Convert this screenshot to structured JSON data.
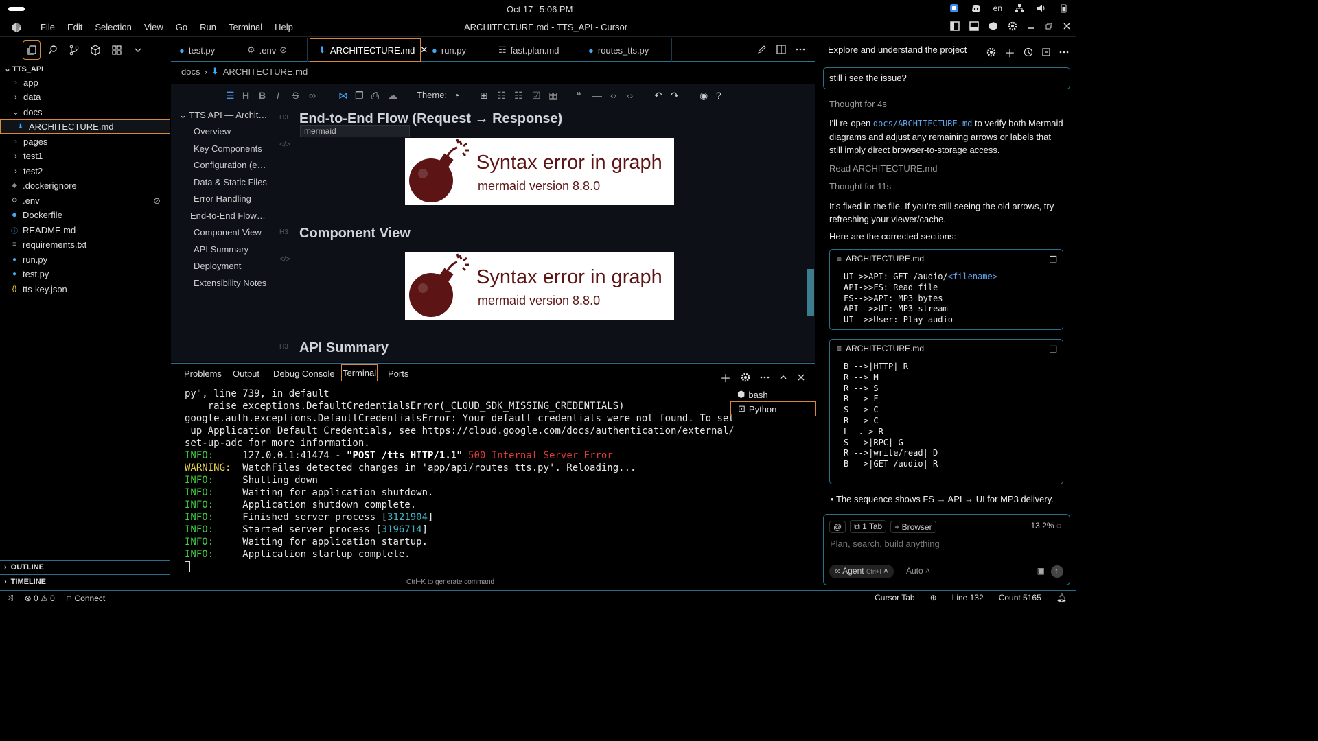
{
  "system": {
    "date": "Oct 17",
    "time": "5:06 PM",
    "lang": "en"
  },
  "window": {
    "title": "ARCHITECTURE.md - TTS_API - Cursor"
  },
  "menu": [
    "File",
    "Edit",
    "Selection",
    "View",
    "Go",
    "Run",
    "Terminal",
    "Help"
  ],
  "explorer": {
    "root": "TTS_API",
    "items": [
      {
        "label": "app",
        "kind": "folder"
      },
      {
        "label": "data",
        "kind": "folder"
      },
      {
        "label": "docs",
        "kind": "folder-open"
      },
      {
        "label": "ARCHITECTURE.md",
        "kind": "md"
      },
      {
        "label": "pages",
        "kind": "folder"
      },
      {
        "label": "test1",
        "kind": "folder"
      },
      {
        "label": "test2",
        "kind": "folder"
      },
      {
        "label": ".dockerignore",
        "kind": "docker"
      },
      {
        "label": ".env",
        "kind": "gear"
      },
      {
        "label": "Dockerfile",
        "kind": "docker"
      },
      {
        "label": "README.md",
        "kind": "info"
      },
      {
        "label": "requirements.txt",
        "kind": "lines"
      },
      {
        "label": "run.py",
        "kind": "py"
      },
      {
        "label": "test.py",
        "kind": "py"
      },
      {
        "label": "tts-key.json",
        "kind": "json"
      }
    ],
    "outline": "OUTLINE",
    "timeline": "TIMELINE"
  },
  "tabs": [
    "test.py",
    ".env",
    "ARCHITECTURE.md",
    "run.py",
    "fast.plan.md",
    "routes_tts.py"
  ],
  "breadcrumb": [
    "docs",
    "ARCHITECTURE.md"
  ],
  "toolbar": {
    "theme_label": "Theme:"
  },
  "toc": {
    "root": "TTS API — Archit…",
    "items": [
      "Overview",
      "Key Components",
      "Configuration (e…",
      "Data & Static Files",
      "Error Handling",
      "End-to-End Flow…",
      "Component View",
      "API Summary",
      "Deployment",
      "Extensibility Notes"
    ]
  },
  "doc": {
    "h3_tag": "H3",
    "code_tag": "</>",
    "tooltip": "mermaid",
    "headings": [
      "End-to-End Flow (Request → Response)",
      "Component View",
      "API Summary"
    ],
    "error_title": "Syntax error in graph",
    "error_version": "mermaid version 8.8.0"
  },
  "panel": {
    "tabs": [
      "Problems",
      "Output",
      "Debug Console",
      "Terminal",
      "Ports"
    ],
    "terminals": [
      "bash",
      "Python"
    ],
    "hint": "Ctrl+K to generate command",
    "lines": {
      "l1": "py\", line 739, in default",
      "l2": "    raise exceptions.DefaultCredentialsError(_CLOUD_SDK_MISSING_CREDENTIALS)",
      "l3": "google.auth.exceptions.DefaultCredentialsError: Your default credentials were not found. To set",
      "l4": " up Application Default Credentials, see https://cloud.google.com/docs/authentication/external/",
      "l5": "set-up-adc for more information.",
      "info": "INFO:",
      "warning": "WARNING:",
      "l6a": "     127.0.0.1:41474 - ",
      "l6b": "\"POST /tts HTTP/1.1\"",
      "l6c": "500 Internal Server Error",
      "l7": "  WatchFiles detected changes in 'app/api/routes_tts.py'. Reloading...",
      "l8": "     Shutting down",
      "l9": "     Waiting for application shutdown.",
      "l10": "     Application shutdown complete.",
      "l11a": "     Finished server process [",
      "l11b": "3121904",
      "l12a": "     Started server process [",
      "l12b": "3196714",
      "l13": "     Waiting for application startup.",
      "l14": "     Application startup complete.",
      "bracket": "]"
    }
  },
  "status": {
    "errors": "0",
    "warnings": "0",
    "connect": "Connect",
    "cursor_tab": "Cursor Tab",
    "line": "Line 132",
    "count": "Count 5165"
  },
  "chat": {
    "title": "Explore and understand the project",
    "user_message": "still i see the issue?",
    "thought1": "Thought for 4s",
    "p1_pre": "I'll re-open ",
    "p1_code": "docs/ARCHITECTURE.md",
    "p1_post": " to verify both Mermaid diagrams and adjust any remaining arrows or labels that still imply direct browser-to-storage access.",
    "read": "Read ARCHITECTURE.md",
    "thought2": "Thought for 11s",
    "p2": "It's fixed in the file. If you're still seeing the old arrows, try refreshing your viewer/cache.",
    "p3": "Here are the corrected sections:",
    "card_title": "ARCHITECTURE.md",
    "code1": [
      "UI->>API: GET /audio/",
      "API->>FS: Read file",
      "FS-->>API: MP3 bytes",
      "API-->>UI: MP3 stream",
      "UI-->>User: Play audio"
    ],
    "code1_link": "<filename>",
    "code2": [
      "B -->|HTTP| R",
      "R --> M",
      "R --> S",
      "R --> F",
      "S --> C",
      "R --> C",
      "L -.-> R",
      "S -->|RPC| G",
      "R -->|write/read| D",
      "B -->|GET /audio| R"
    ],
    "bullet": "The sequence shows FS → API → UI for MP3 delivery.",
    "composer": {
      "tab_chip": "1 Tab",
      "browser_chip": "Browser",
      "percent": "13.2%",
      "placeholder": "Plan, search, build anything",
      "agent": "Agent",
      "agent_kbd": "Ctrl+I",
      "auto": "Auto"
    }
  }
}
